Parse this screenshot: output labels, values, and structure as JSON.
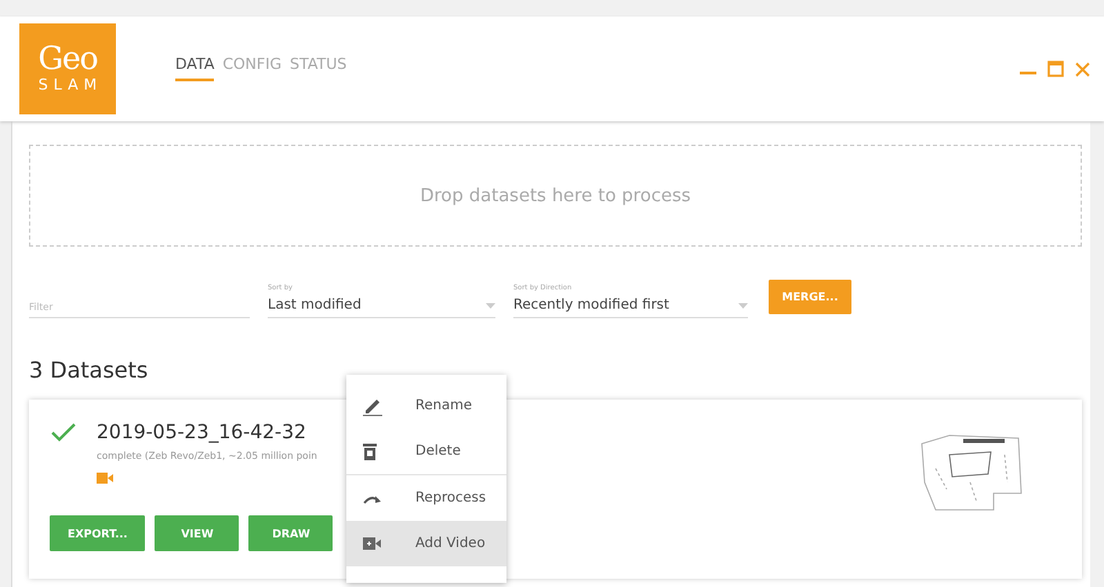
{
  "logo": {
    "word": "Geo",
    "subword": "SLAM"
  },
  "tabs": [
    {
      "label": "DATA",
      "selected": true
    },
    {
      "label": "CONFIG",
      "selected": false
    },
    {
      "label": "STATUS",
      "selected": false
    }
  ],
  "drop_zone": {
    "text": "Drop datasets here to process"
  },
  "filter": {
    "placeholder": "Filter"
  },
  "sort_by": {
    "label": "Sort by",
    "value": "Last modified"
  },
  "sort_direction": {
    "label": "Sort by Direction",
    "value": "Recently modified first"
  },
  "merge_button": "MERGE...",
  "datasets_heading": "3 Datasets",
  "datasets": [
    {
      "name": "2019-05-23_16-42-32",
      "status": "complete (Zeb Revo/Zeb1, ~2.05 million poin",
      "complete": true,
      "has_video": true,
      "buttons": [
        "EXPORT...",
        "VIEW",
        "DRAW"
      ]
    }
  ],
  "context_menu": [
    {
      "kind": "rename",
      "label": "Rename",
      "selected": false
    },
    {
      "kind": "delete",
      "label": "Delete",
      "selected": false
    },
    {
      "kind": "reprocess",
      "label": "Reprocess",
      "selected": false
    },
    {
      "kind": "video",
      "label": "Add Video",
      "selected": true
    }
  ]
}
